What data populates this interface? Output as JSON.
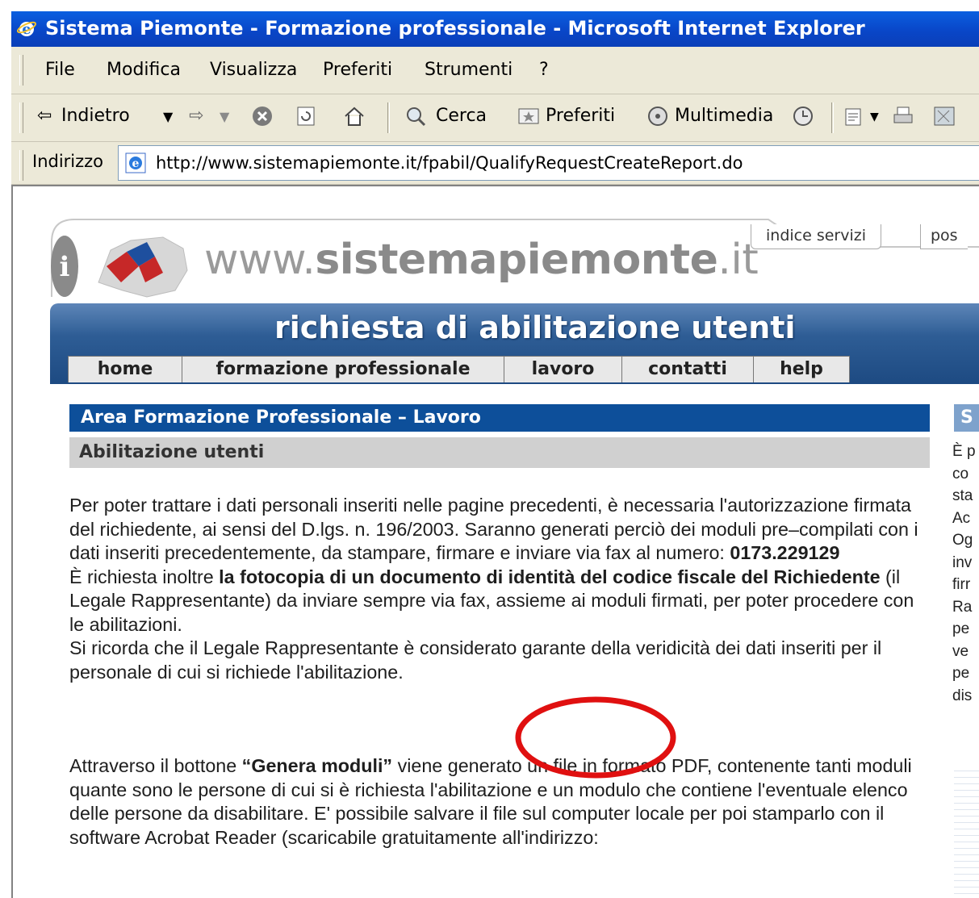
{
  "window": {
    "title": "Sistema Piemonte - Formazione professionale - Microsoft Internet Explorer"
  },
  "menu": [
    "File",
    "Modifica",
    "Visualizza",
    "Preferiti",
    "Strumenti",
    "?"
  ],
  "toolbar": {
    "back": "Indietro",
    "search": "Cerca",
    "favorites": "Preferiti",
    "media": "Multimedia"
  },
  "address": {
    "label": "Indirizzo",
    "url": "http://www.sistemapiemonte.it/fpabil/QualifyRequestCreateReport.do"
  },
  "site": {
    "name_prefix": "www.",
    "name_main": "sistemapiemonte",
    "name_suffix": ".it",
    "tab_indice": "indice servizi",
    "tab_post": "pos"
  },
  "banner": {
    "title": "richiesta di abilitazione utenti"
  },
  "nav": [
    "home",
    "formazione professionale",
    "lavoro",
    "contatti",
    "help"
  ],
  "section": {
    "title": "Area Formazione Professionale – Lavoro",
    "subtitle": "Abilitazione utenti"
  },
  "body": {
    "p1_a": "Per poter trattare i dati personali inseriti nelle pagine precedenti, è necessaria l'autorizzazione firmata del richiedente, ai sensi del D.lgs. n. 196/2003. Saranno generati perciò dei moduli pre–compilati con i dati inseriti precedentemente, da stampare, firmare e inviare via fax al numero: ",
    "p1_fax": "0173.229129",
    "p1_b": "È richiesta inoltre ",
    "p1_bold": "la fotocopia di un documento di identità del codice fiscale del Richiedente",
    "p1_c": " (il Legale Rappresentante) da inviare sempre via fax, assieme ai moduli firmati, per poter procedere con le abilitazioni.",
    "p1_d": "Si ricorda che il Legale Rappresentante è considerato garante della veridicità dei dati inseriti per il personale di cui si richiede l'abilitazione.",
    "p2_a": "Attraverso il bottone ",
    "p2_button": "“Genera moduli”",
    "p2_b": " viene generato un file in formato PDF, contenente tanti moduli quante sono le persone di cui si è richiesta l'abilitazione e un modulo che contiene l'eventuale elenco delle persone da disabilitare. E' possibile salvare il file sul computer locale per poi stamparlo con il software Acrobat Reader (scaricabile gratuitamente all'indirizzo:"
  },
  "right_column": {
    "head": "S",
    "lines": [
      "È p",
      "co",
      "sta",
      "Ac",
      "Og",
      "inv",
      "firr",
      "Ra",
      "pe",
      "ve",
      "pe",
      "dis"
    ]
  },
  "colors": {
    "titlebar": "#0a4fd8",
    "chrome": "#ece9d8",
    "section_blue": "#0d4f9a",
    "banner_blue": "#2e5d95",
    "annotation_red": "#e01010"
  }
}
